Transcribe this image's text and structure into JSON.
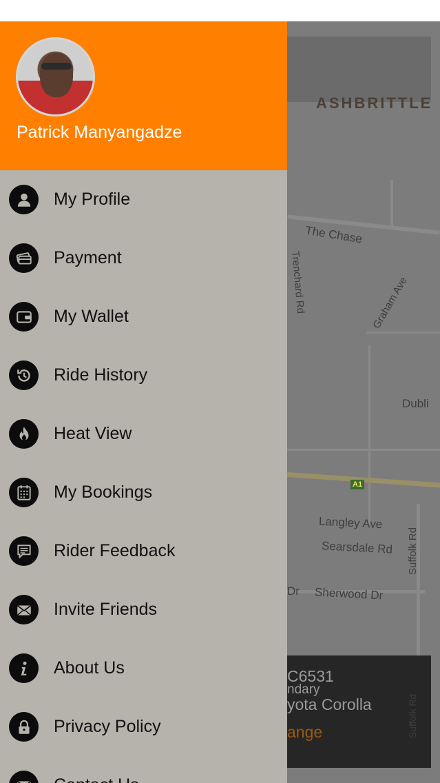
{
  "user": {
    "name": "Patrick Manyangadze"
  },
  "menu": {
    "items": [
      {
        "label": "My Profile",
        "icon": "user-icon"
      },
      {
        "label": "Payment",
        "icon": "credit-card-icon"
      },
      {
        "label": "My Wallet",
        "icon": "wallet-icon"
      },
      {
        "label": "Ride History",
        "icon": "history-icon"
      },
      {
        "label": "Heat View",
        "icon": "flame-icon"
      },
      {
        "label": "My Bookings",
        "icon": "calendar-icon"
      },
      {
        "label": "Rider Feedback",
        "icon": "feedback-icon"
      },
      {
        "label": "Invite Friends",
        "icon": "envelope-icon"
      },
      {
        "label": "About Us",
        "icon": "info-icon"
      },
      {
        "label": "Privacy Policy",
        "icon": "lock-icon"
      },
      {
        "label": "Contact Us",
        "icon": "contact-icon"
      }
    ]
  },
  "map": {
    "labels": {
      "area": "ASHBRITTLE",
      "chase": "The Chase",
      "trenchard": "Trenchard Rd",
      "graham": "Graham Ave",
      "dublin": "Dubli",
      "langley": "Langley Ave",
      "searsdale": "Searsdale Rd",
      "suffolk": "Suffolk Rd",
      "sherwood": "Sherwood Dr",
      "dr": "Dr",
      "suffolk2": "Suffolk Rd",
      "road_shield": "A1"
    },
    "car": {
      "plate": "C6531",
      "line2": "ndary",
      "model": "yota Corolla",
      "action": "ange"
    }
  },
  "colors": {
    "header": "#ff8000",
    "drawer": "#b5b3ac",
    "icon_bg": "#0c0c0c"
  }
}
